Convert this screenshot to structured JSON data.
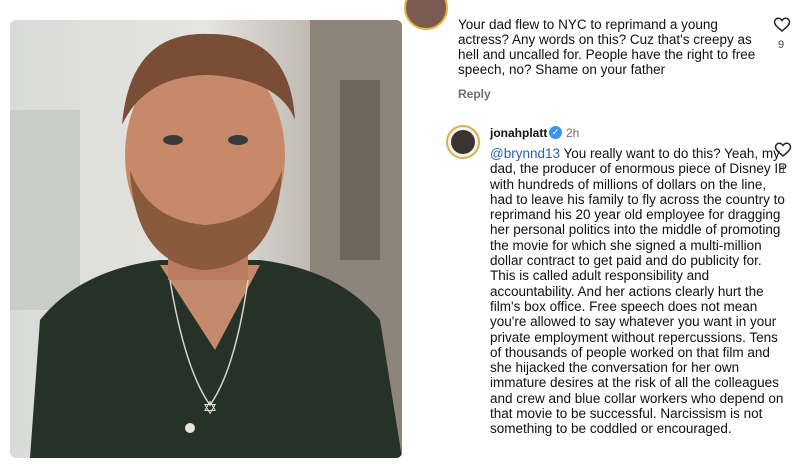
{
  "top_comment": {
    "text": "Your dad flew to NYC to reprimand a young actress? Any words on this? Cuz that's creepy as hell and uncalled for. People have the right to free speech, no? Shame on your father",
    "reply_label": "Reply",
    "like_count": "9"
  },
  "reply_comment": {
    "username": "jonahplatt",
    "time": "2h",
    "mention": "@brynnd13",
    "text": " You really want to do this? Yeah, my dad, the producer of enormous piece of Disney IP with hundreds of millions of dollars on the line, had to leave his family to fly across the country to reprimand his 20 year old employee for dragging her personal politics into the middle of promoting the movie for which she signed a multi-million dollar contract to get paid and do publicity for. This is called adult responsibility and accountability. And her actions clearly hurt the film's box office. Free speech does not mean you're allowed to say whatever you want in your private employment without repercussions. Tens of thousands of people worked on that film and she hijacked the conversation for her own immature desires at the risk of all the colleagues and crew and blue collar workers who depend on that movie to be successful. Narcissism is not something to be coddled or encouraged.",
    "like_count": "1"
  },
  "icons": {
    "like": "heart-icon",
    "verified": "verified-badge-icon"
  },
  "colors": {
    "mention": "#2b5fae",
    "verified": "#3b95f0",
    "avatar_ring": "#d4b24a"
  }
}
